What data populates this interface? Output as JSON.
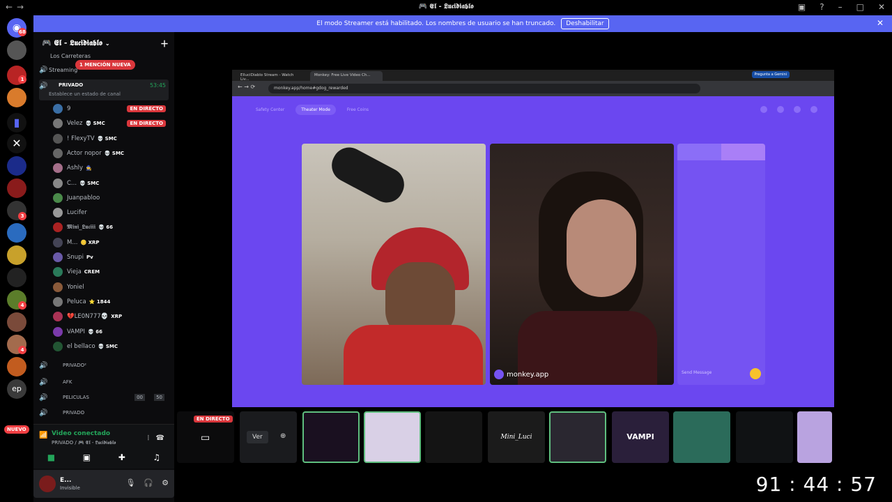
{
  "window": {
    "title": "🎮 𝕰𝖑 - 𝕷𝖚𝖈𝖎𝖉𝖎𝖆𝖇𝖑𝖔"
  },
  "banner": {
    "text": "El modo Streamer está habilitado. Los nombres de usuario se han truncado.",
    "button": "Deshabilitar"
  },
  "guild_badges": {
    "top": "68",
    "new": "NUEVO",
    "b1": "1",
    "b2": "1",
    "b3": "3",
    "b4": "4",
    "b5": "4"
  },
  "server": {
    "name": "🎮 𝕰𝖑 - 𝕷𝖚𝖈𝖎𝖉𝖎𝖆𝖇𝖑𝖔"
  },
  "channels": {
    "carreteras": "Los Carreteras",
    "streaming": "Streaming",
    "mention": "1 MENCIÓN NUEVA",
    "privado": "PRIVADO",
    "privado_time": "53:45",
    "status_prompt": "Establece un estado de canal",
    "privado2": "PRIVADO²",
    "afk": "AFK",
    "peliculas": "PELICULAS",
    "peliculas_count1": "00",
    "peliculas_count2": "50",
    "privado3": "PRIVADO"
  },
  "users": [
    {
      "name": "9",
      "tag": "",
      "live": "EN DIRECTO"
    },
    {
      "name": "Velez",
      "tag": "💀 SMC",
      "live": "EN DIRECTO"
    },
    {
      "name": "! FlexyTV",
      "tag": "💀 SMC",
      "live": ""
    },
    {
      "name": "Actor nopor",
      "tag": "💀 SMC",
      "live": ""
    },
    {
      "name": "Ashly",
      "tag": "🧙",
      "live": ""
    },
    {
      "name": "C...",
      "tag": "💀 SMC",
      "live": ""
    },
    {
      "name": "Juanpabloo",
      "tag": "",
      "live": ""
    },
    {
      "name": "Lucifer",
      "tag": "",
      "live": ""
    },
    {
      "name": "𝕸𝖎𝖓𝖎_𝕷𝖚𝖈𝖎𝖎𝖎",
      "tag": "💀 66",
      "live": ""
    },
    {
      "name": "M...",
      "tag": "🪙 XRP",
      "live": ""
    },
    {
      "name": "Snupi",
      "tag": "Pv",
      "live": ""
    },
    {
      "name": "Vieja",
      "tag": "CREM",
      "live": ""
    },
    {
      "name": "Yoniel",
      "tag": "",
      "live": ""
    },
    {
      "name": "Peluca",
      "tag": "⭐ 1844",
      "live": ""
    },
    {
      "name": "💔LE0N777💀",
      "tag": "XRP",
      "live": ""
    },
    {
      "name": "VAMPI",
      "tag": "💀 66",
      "live": ""
    },
    {
      "name": "el bellaco",
      "tag": "💀 SMC",
      "live": ""
    }
  ],
  "voice": {
    "connected": "Video conectado",
    "location": "PRIVADO / 🎮 𝕰𝖑 - 𝕷𝖚𝖈𝖎𝖉𝖎𝖆𝖇𝖑𝖔"
  },
  "me": {
    "name": "E...",
    "status": "Invisible"
  },
  "browser": {
    "tab1": "ElluciDiablo Stream - Watch Liv...",
    "tab2": "Monkey: Free Live Video Ch...",
    "url": "monkey.app/home#gdog_rewarded",
    "gemini": "Pregunta a Gemini"
  },
  "monkey": {
    "nav": [
      "Safety Center",
      "Theater Mode",
      "Free Coins"
    ],
    "send_placeholder": "Send Message",
    "watermark": "monkey.app"
  },
  "tiles": {
    "live": "EN DIRECTO",
    "ver": "Ver",
    "tile5": "Mini_Luci",
    "tile7": "VAMPI"
  },
  "clock": "91 : 44 : 57"
}
